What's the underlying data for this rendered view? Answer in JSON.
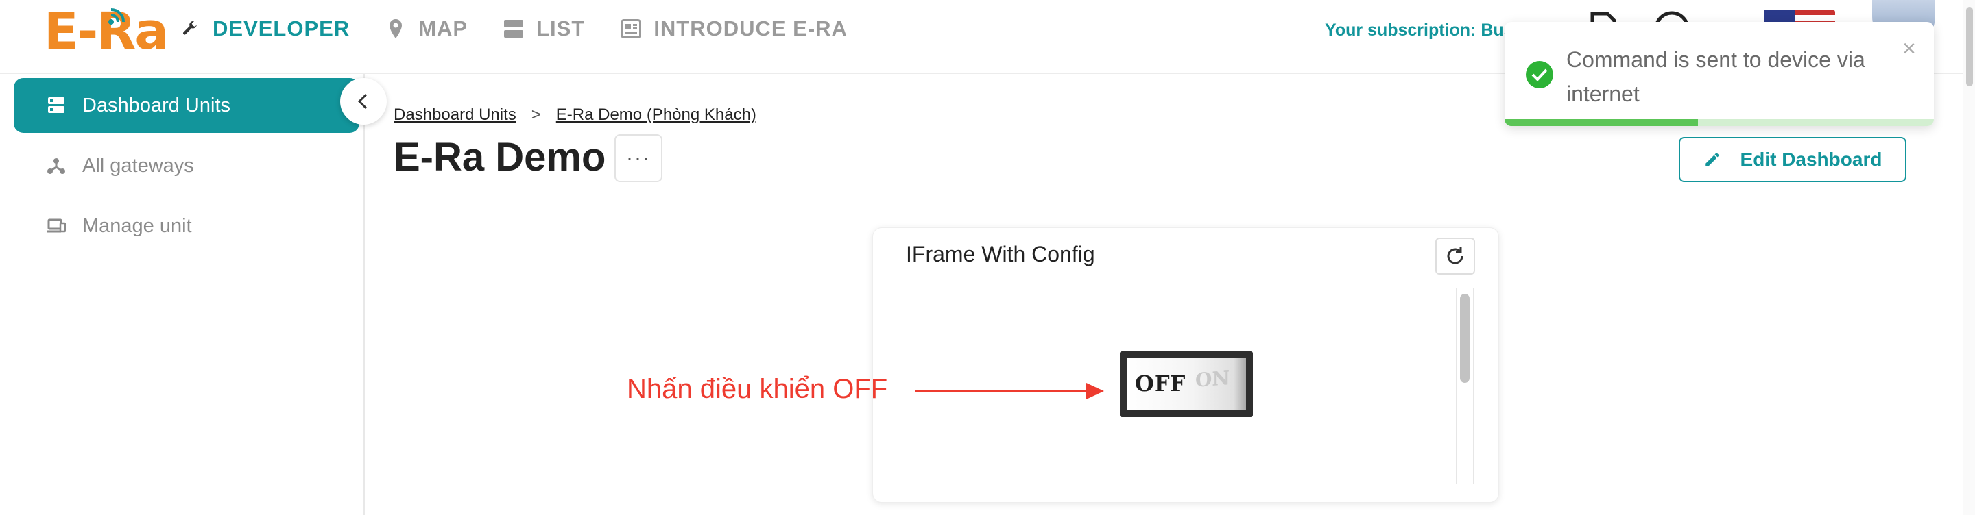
{
  "app": {
    "logo_text": "E-Ra"
  },
  "nav": [
    {
      "label": "DEVELOPER",
      "icon": "wrench-icon",
      "active": true
    },
    {
      "label": "MAP",
      "icon": "map-pin-icon",
      "active": false
    },
    {
      "label": "LIST",
      "icon": "list-icon",
      "active": false
    },
    {
      "label": "INTRODUCE E-RA",
      "icon": "news-icon",
      "active": false
    }
  ],
  "header": {
    "subscription": "Your subscription: Bus",
    "icons": [
      "document-icon",
      "help-icon",
      "us-flag-icon",
      "user-avatar"
    ]
  },
  "sidebar": {
    "items": [
      {
        "label": "Dashboard Units",
        "icon": "dashboard-icon",
        "active": true
      },
      {
        "label": "All gateways",
        "icon": "gateway-icon",
        "active": false
      },
      {
        "label": "Manage unit",
        "icon": "devices-icon",
        "active": false
      }
    ],
    "collapse_icon": "chevron-left-icon"
  },
  "breadcrumb": {
    "items": [
      "Dashboard Units",
      "E-Ra Demo (Phòng Khách)"
    ],
    "separator": ">"
  },
  "page": {
    "title": "E-Ra Demo",
    "more_label": "···",
    "edit_label": "Edit Dashboard"
  },
  "widget": {
    "title": "IFrame With Config",
    "switch_off": "OFF",
    "switch_on": "ON",
    "switch_state": "OFF"
  },
  "annotation": {
    "text": "Nhấn điều khiển OFF"
  },
  "toast": {
    "message": "Command is sent to device via internet",
    "close": "×",
    "status": "success",
    "progress": 0.45
  },
  "colors": {
    "brand_teal": "#12959b",
    "logo_orange": "#f08a24",
    "annotation_red": "#ee3b2f",
    "success_green": "#5cc557"
  }
}
